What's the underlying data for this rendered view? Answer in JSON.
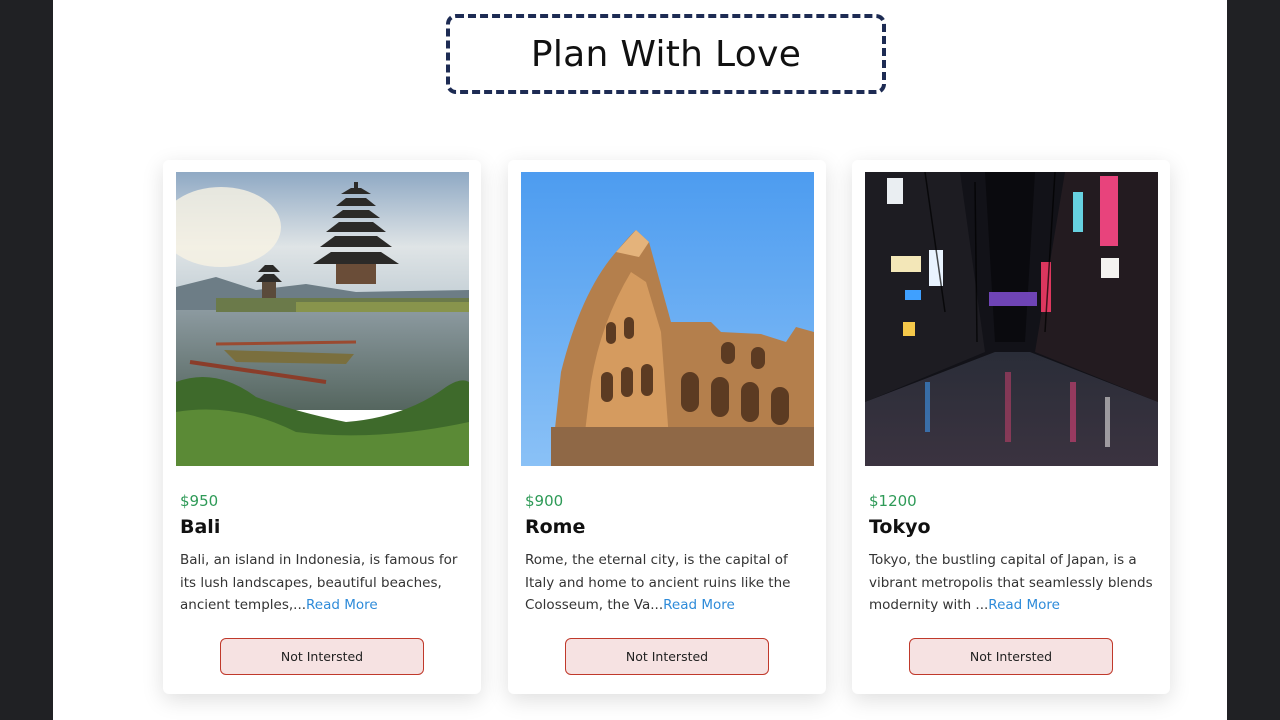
{
  "page_title": "Plan With Love",
  "tours": [
    {
      "price": "$950",
      "name": "Bali",
      "description": "Bali, an island in Indonesia, is famous for its lush landscapes, beautiful beaches, ancient temples,...",
      "read_more": "Read More",
      "button": "Not Intersted",
      "image": "pagoda-lake-photo"
    },
    {
      "price": "$900",
      "name": "Rome",
      "description": "Rome, the eternal city, is the capital of Italy and home to ancient ruins like the Colosseum, the Va...",
      "read_more": "Read More",
      "button": "Not Intersted",
      "image": "colosseum-photo"
    },
    {
      "price": "$1200",
      "name": "Tokyo",
      "description": "Tokyo, the bustling capital of Japan, is a vibrant metropolis that seamlessly blends modernity with ...",
      "read_more": "Read More",
      "button": "Not Intersted",
      "image": "night-street-photo"
    }
  ],
  "colors": {
    "price": "#2e9a57",
    "link": "#2e8bd9",
    "button_border": "#c0392b",
    "button_bg": "#f6e2e2",
    "title_border": "#1d2b53"
  }
}
